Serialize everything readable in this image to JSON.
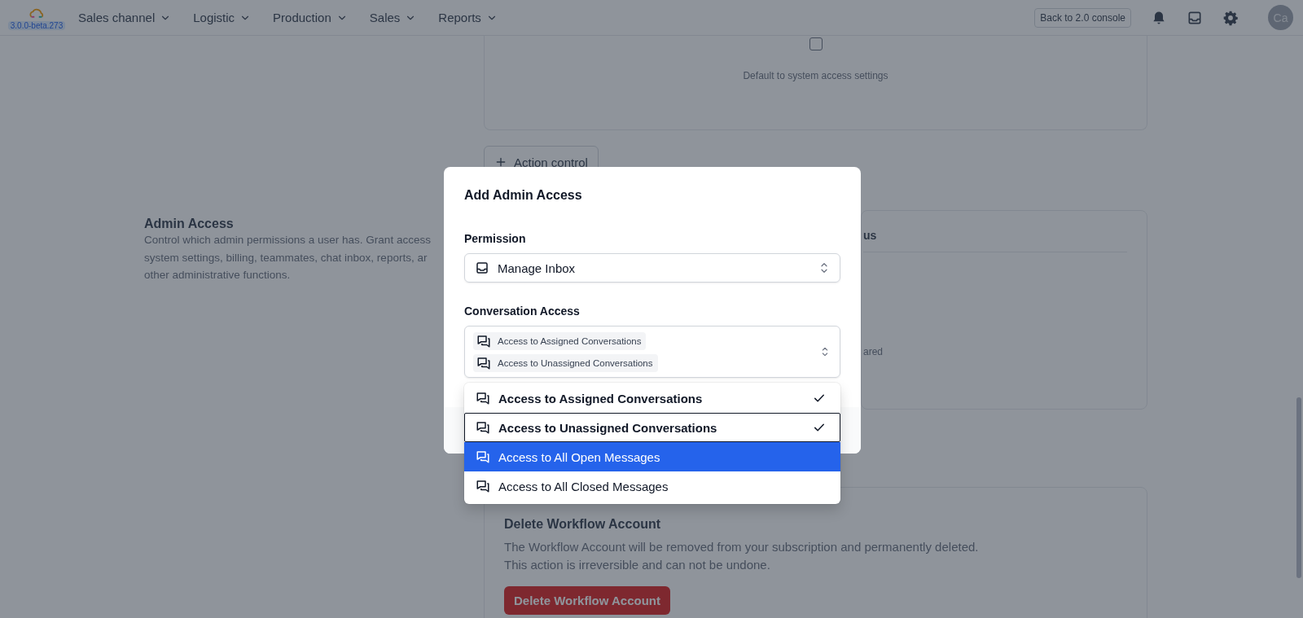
{
  "header": {
    "version": "3.0.0-beta.273",
    "nav": [
      {
        "label": "Sales channel"
      },
      {
        "label": "Logistic"
      },
      {
        "label": "Production"
      },
      {
        "label": "Sales"
      },
      {
        "label": "Reports"
      }
    ],
    "console_button": "Back to 2.0 console",
    "avatar": "Ca"
  },
  "background": {
    "access_card": {
      "checked": false,
      "note": "Default to system access settings"
    },
    "action_button": "Action control",
    "admin_access": {
      "title": "Admin Access",
      "lines": [
        "Control which admin permissions a user has. Grant access",
        "system settings, billing, teammates, chat inbox, reports, ar",
        "other administrative functions."
      ]
    },
    "side_card": {
      "header": "us",
      "note": "ared"
    },
    "delete_section": {
      "title": "Delete Workflow Account",
      "lines": [
        "The Workflow Account will be removed from your subscription and permanently deleted.",
        "This action is irreversible and can not be undone."
      ],
      "button": "Delete Workflow Account"
    }
  },
  "modal": {
    "title": "Add Admin Access",
    "permission": {
      "label": "Permission",
      "value": "Manage Inbox"
    },
    "conversation_access": {
      "label": "Conversation Access",
      "tags": [
        "Access to Assigned Conversations",
        "Access to Unassigned Conversations"
      ]
    },
    "options": [
      {
        "label": "Access to Assigned Conversations",
        "checked": true,
        "focused": false,
        "highlighted": false
      },
      {
        "label": "Access to Unassigned Conversations",
        "checked": true,
        "focused": true,
        "highlighted": false
      },
      {
        "label": "Access to All Open Messages",
        "checked": false,
        "focused": false,
        "highlighted": true
      },
      {
        "label": "Access to All Closed Messages",
        "checked": false,
        "focused": false,
        "highlighted": false
      }
    ]
  }
}
